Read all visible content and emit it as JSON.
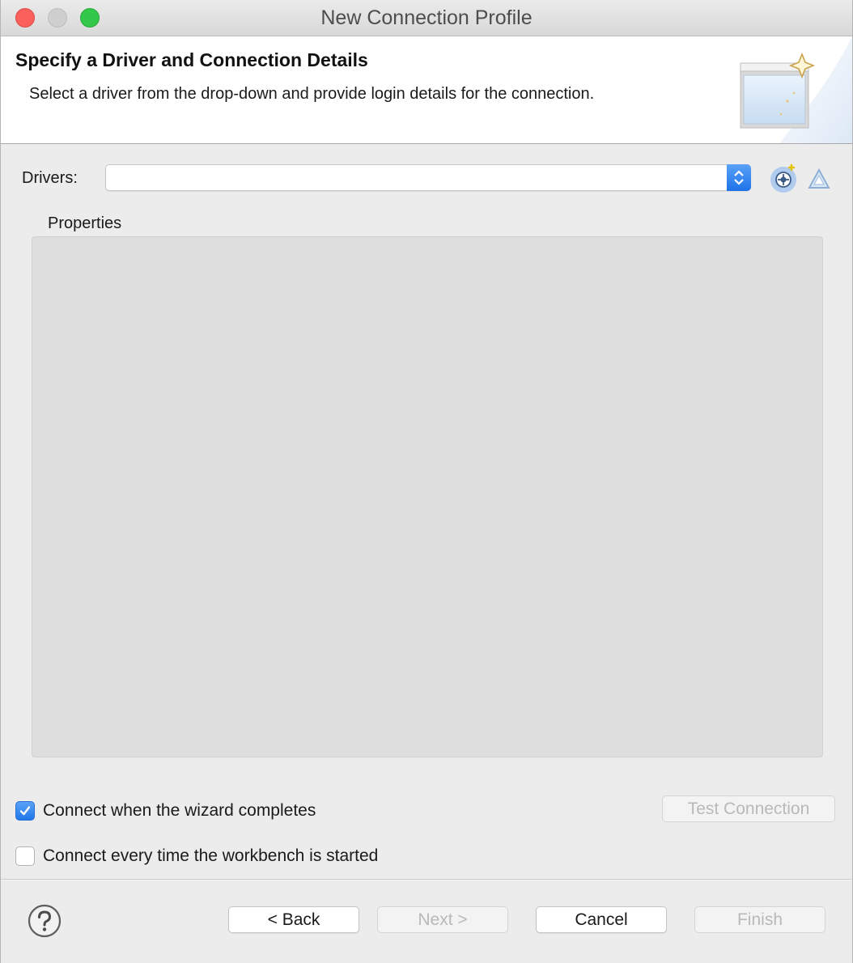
{
  "window": {
    "title": "New Connection Profile"
  },
  "banner": {
    "title": "Specify a Driver and Connection Details",
    "description": "Select a driver from the drop-down and provide login details for the connection."
  },
  "drivers": {
    "label": "Drivers:",
    "selected": ""
  },
  "properties": {
    "label": "Properties"
  },
  "options": {
    "connect_on_complete": {
      "label": "Connect when the wizard completes",
      "checked": true
    },
    "connect_on_startup": {
      "label": "Connect every time the workbench is started",
      "checked": false
    }
  },
  "buttons": {
    "test_connection": "Test Connection",
    "back": "< Back",
    "next": "Next >",
    "cancel": "Cancel",
    "finish": "Finish"
  },
  "icons": {
    "new_driver": "new-driver-icon",
    "edit_driver": "edit-driver-icon",
    "help": "help-icon"
  },
  "colors": {
    "accent": "#2077ea",
    "close": "#fc605c",
    "maximize": "#34c84a"
  }
}
